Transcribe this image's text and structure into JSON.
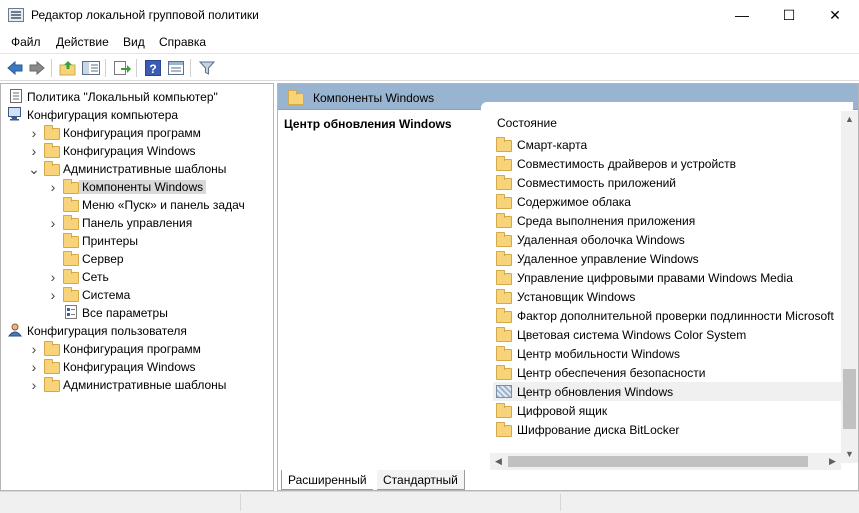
{
  "window": {
    "title": "Редактор локальной групповой политики",
    "minimize": "—",
    "maximize": "☐",
    "close": "✕"
  },
  "menu": [
    "Файл",
    "Действие",
    "Вид",
    "Справка"
  ],
  "tree": [
    {
      "label": "Политика \"Локальный компьютер\"",
      "level": 0,
      "expander": "",
      "icon": "policy-icon"
    },
    {
      "label": "Конфигурация компьютера",
      "level": 0,
      "expander": "expanded",
      "icon": "computer-icon"
    },
    {
      "label": "Конфигурация программ",
      "level": 1,
      "expander": "collapsed",
      "icon": "folder-icon"
    },
    {
      "label": "Конфигурация Windows",
      "level": 1,
      "expander": "collapsed",
      "icon": "folder-icon"
    },
    {
      "label": "Административные шаблоны",
      "level": 1,
      "expander": "expanded",
      "icon": "folder-icon"
    },
    {
      "label": "Компоненты Windows",
      "level": 2,
      "expander": "collapsed",
      "icon": "folder-icon",
      "selected": true
    },
    {
      "label": "Меню «Пуск» и панель задач",
      "level": 2,
      "expander": "",
      "icon": "folder-icon"
    },
    {
      "label": "Панель управления",
      "level": 2,
      "expander": "collapsed",
      "icon": "folder-icon"
    },
    {
      "label": "Принтеры",
      "level": 2,
      "expander": "",
      "icon": "folder-icon"
    },
    {
      "label": "Сервер",
      "level": 2,
      "expander": "",
      "icon": "folder-icon"
    },
    {
      "label": "Сеть",
      "level": 2,
      "expander": "collapsed",
      "icon": "folder-icon"
    },
    {
      "label": "Система",
      "level": 2,
      "expander": "collapsed",
      "icon": "folder-icon"
    },
    {
      "label": "Все параметры",
      "level": 2,
      "expander": "",
      "icon": "settings-page-icon"
    },
    {
      "label": "Конфигурация пользователя",
      "level": 0,
      "expander": "expanded",
      "icon": "user-icon"
    },
    {
      "label": "Конфигурация программ",
      "level": 1,
      "expander": "collapsed",
      "icon": "folder-icon"
    },
    {
      "label": "Конфигурация Windows",
      "level": 1,
      "expander": "collapsed",
      "icon": "folder-icon"
    },
    {
      "label": "Административные шаблоны",
      "level": 1,
      "expander": "collapsed",
      "icon": "folder-icon"
    }
  ],
  "details": {
    "header": "Компоненты Windows",
    "description_title": "Центр обновления Windows",
    "column_header": "Состояние",
    "items": [
      {
        "label": "Смарт-карта",
        "icon": "folder-icon"
      },
      {
        "label": "Совместимость драйверов и устройств",
        "icon": "folder-icon"
      },
      {
        "label": "Совместимость приложений",
        "icon": "folder-icon"
      },
      {
        "label": "Содержимое облака",
        "icon": "folder-icon"
      },
      {
        "label": "Среда выполнения приложения",
        "icon": "folder-icon"
      },
      {
        "label": "Удаленная оболочка Windows",
        "icon": "folder-icon"
      },
      {
        "label": "Удаленное управление Windows",
        "icon": "folder-icon"
      },
      {
        "label": "Управление цифровыми правами Windows Media",
        "icon": "folder-icon"
      },
      {
        "label": "Установщик Windows",
        "icon": "folder-icon"
      },
      {
        "label": "Фактор дополнительной проверки подлинности Microsoft",
        "icon": "folder-icon"
      },
      {
        "label": "Цветовая система Windows Color System",
        "icon": "folder-icon"
      },
      {
        "label": "Центр мобильности Windows",
        "icon": "folder-icon"
      },
      {
        "label": "Центр обеспечения безопасности",
        "icon": "folder-icon"
      },
      {
        "label": "Центр обновления Windows",
        "icon": "setting-icon",
        "highlighted": true
      },
      {
        "label": "Цифровой ящик",
        "icon": "folder-icon"
      },
      {
        "label": "Шифрование диска BitLocker",
        "icon": "folder-icon"
      }
    ]
  },
  "tabs": {
    "extended": "Расширенный",
    "standard": "Стандартный"
  },
  "colors": {
    "header_bg": "#99b4d1",
    "folder_fill": "#f7d479",
    "selection": "#d9d9d9"
  }
}
